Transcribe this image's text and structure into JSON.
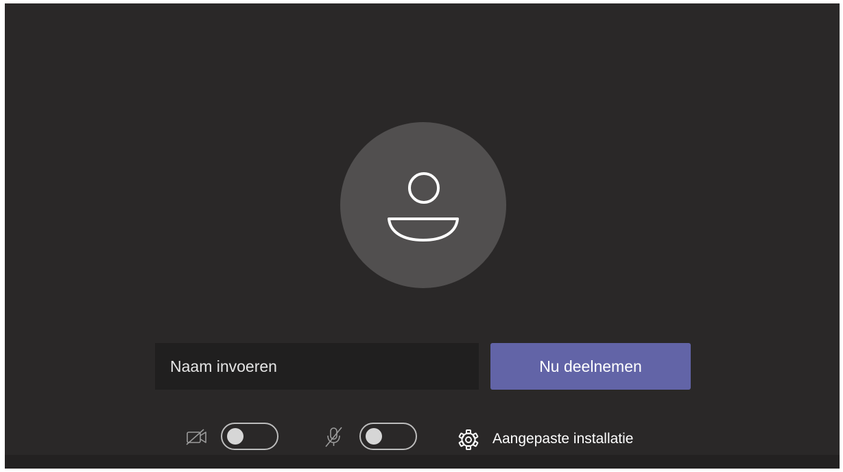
{
  "join_screen": {
    "name_input": {
      "placeholder": "Naam invoeren",
      "value": ""
    },
    "join_button_label": "Nu deelnemen"
  },
  "device_controls": {
    "camera": {
      "icon": "camera-off-icon",
      "enabled": false
    },
    "microphone": {
      "icon": "microphone-off-icon",
      "enabled": false
    },
    "settings": {
      "icon": "gear-icon",
      "label": "Aangepaste installatie"
    }
  },
  "colors": {
    "background": "#2a2828",
    "avatar_circle": "#514f4f",
    "input_background": "#201f1f",
    "accent": "#6264a7"
  }
}
